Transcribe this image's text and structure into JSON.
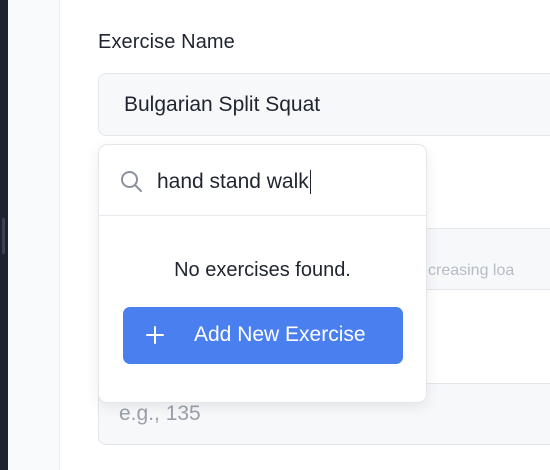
{
  "form": {
    "exercise_label": "Exercise Name",
    "exercise_value": "Bulgarian Split Squat",
    "hidden_field_text": "creasing loa",
    "weight_placeholder": "e.g., 135"
  },
  "dropdown": {
    "search_value": "hand stand walk",
    "empty_message": "No exercises found.",
    "add_button_label": "Add New Exercise",
    "search_icon": "search-icon",
    "add_icon": "plus-icon"
  },
  "colors": {
    "accent": "#4a7ff0",
    "sidebar_dark": "#1e2330",
    "field_bg": "#f7f8fa"
  }
}
